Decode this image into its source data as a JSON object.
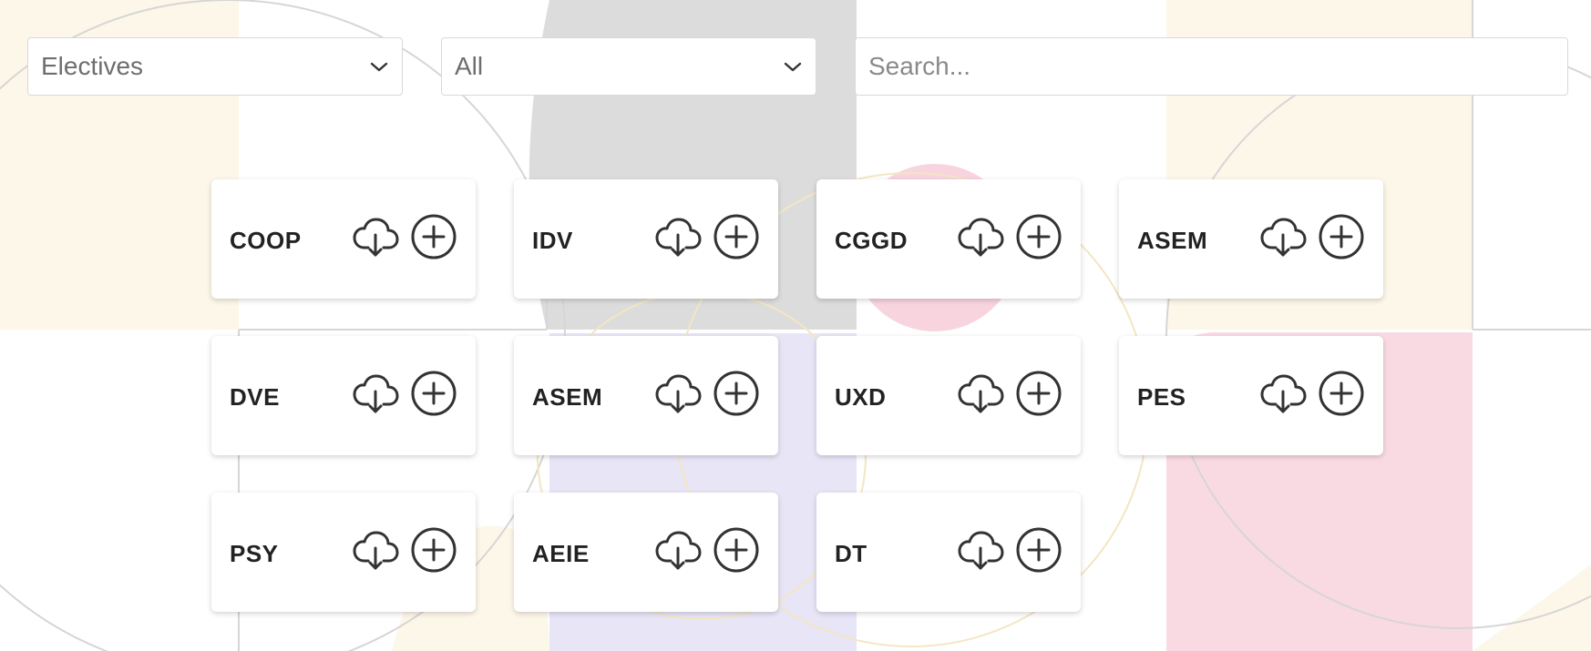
{
  "filters": {
    "category": {
      "selected": "Electives"
    },
    "type": {
      "selected": "All"
    },
    "search": {
      "placeholder": "Search...",
      "value": ""
    }
  },
  "courses": [
    {
      "code": "COOP"
    },
    {
      "code": "IDV"
    },
    {
      "code": "CGGD"
    },
    {
      "code": "ASEM"
    },
    {
      "code": "DVE"
    },
    {
      "code": "ASEM"
    },
    {
      "code": "UXD"
    },
    {
      "code": "PES"
    },
    {
      "code": "PSY"
    },
    {
      "code": "AEIE"
    },
    {
      "code": "DT"
    }
  ],
  "icons": {
    "download": "cloud-download-icon",
    "add": "plus-circle-icon",
    "dropdown": "chevron-down-icon"
  },
  "colors": {
    "text": "#222222",
    "icon": "#333333",
    "border": "#d9d9d9",
    "card": "#ffffff"
  }
}
